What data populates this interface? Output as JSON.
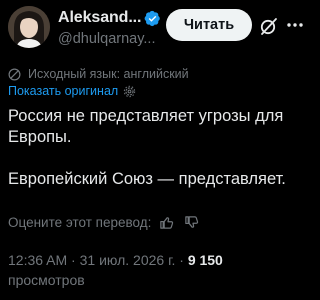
{
  "author": {
    "display_name": "Aleksand...",
    "handle": "@dhulqarnay...",
    "verified": true
  },
  "actions": {
    "follow_label": "Читать"
  },
  "translation": {
    "source_note": "Исходный язык: английский",
    "show_original_label": "Показать оригинал"
  },
  "tweet": {
    "paragraph_1": "Россия не представляет угрозы для Европы.",
    "paragraph_2": "Европейский Союз — представляет."
  },
  "rating": {
    "prompt": "Оцените этот перевод:"
  },
  "meta": {
    "time": "12:36 AM",
    "date": "31 июл. 2026 г.",
    "views_count": "9 150",
    "views_label": "просмотров"
  },
  "colors": {
    "background": "#000000",
    "text": "#e7e9ea",
    "muted": "#71767b",
    "link": "#1d9bf0",
    "verified": "#1d9bf0"
  },
  "icons": {
    "verified": "verified-badge-icon",
    "grok": "grok-icon",
    "more": "more-icon",
    "translate": "globe-icon",
    "settings": "gear-icon",
    "like": "thumb-up-icon",
    "dislike": "thumb-down-icon"
  }
}
